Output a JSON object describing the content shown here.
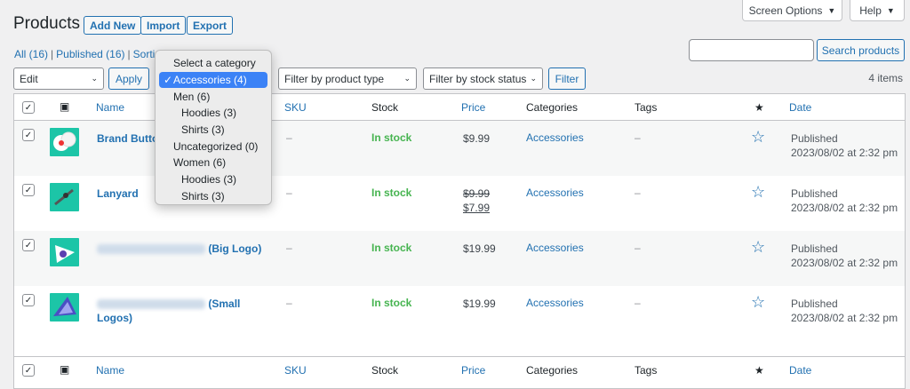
{
  "page": {
    "title": "Products",
    "add_new": "Add New",
    "import": "Import",
    "export": "Export"
  },
  "topbar": {
    "screen_options": "Screen Options",
    "help": "Help"
  },
  "views": {
    "all": "All (16)",
    "published": "Published (16)",
    "sorting": "Sorting"
  },
  "search": {
    "button": "Search products",
    "value": ""
  },
  "filters": {
    "bulk_action": "Edit",
    "apply": "Apply",
    "product_type": "Filter by product type",
    "stock_status": "Filter by stock status",
    "filter": "Filter",
    "items_count": "4 items"
  },
  "columns": {
    "name": "Name",
    "sku": "SKU",
    "stock": "Stock",
    "price": "Price",
    "categories": "Categories",
    "tags": "Tags",
    "date": "Date"
  },
  "category_dropdown": {
    "placeholder": "Select a category",
    "options": [
      {
        "label": "Accessories  (4)",
        "level": 0,
        "selected": true
      },
      {
        "label": "Men  (6)",
        "level": 1,
        "selected": false
      },
      {
        "label": "Hoodies  (3)",
        "level": 2,
        "selected": false
      },
      {
        "label": "Shirts  (3)",
        "level": 2,
        "selected": false
      },
      {
        "label": "Uncategorized  (0)",
        "level": 1,
        "selected": false
      },
      {
        "label": "Women  (6)",
        "level": 1,
        "selected": false
      },
      {
        "label": "Hoodies  (3)",
        "level": 2,
        "selected": false
      },
      {
        "label": "Shirts  (3)",
        "level": 2,
        "selected": false
      }
    ]
  },
  "products": [
    {
      "name": "Brand Butto",
      "name_line2": "",
      "blurred_prefix": false,
      "sku": "–",
      "stock": "In stock",
      "price": "$9.99",
      "sale_price": "",
      "category": "Accessories",
      "tags": "–",
      "status": "Published",
      "date": "2023/08/02 at 2:32 pm"
    },
    {
      "name": "Lanyard",
      "name_line2": "",
      "blurred_prefix": false,
      "sku": "–",
      "stock": "In stock",
      "price": "$9.99",
      "sale_price": "$7.99",
      "category": "Accessories",
      "tags": "–",
      "status": "Published",
      "date": "2023/08/02 at 2:32 pm"
    },
    {
      "name": "(Big Logo)",
      "name_line2": "",
      "blurred_prefix": true,
      "sku": "–",
      "stock": "In stock",
      "price": "$19.99",
      "sale_price": "",
      "category": "Accessories",
      "tags": "–",
      "status": "Published",
      "date": "2023/08/02 at 2:32 pm"
    },
    {
      "name": "(Small",
      "name_line2": "Logos)",
      "blurred_prefix": true,
      "sku": "–",
      "stock": "In stock",
      "price": "$19.99",
      "sale_price": "",
      "category": "Accessories",
      "tags": "–",
      "status": "Published",
      "date": "2023/08/02 at 2:32 pm"
    }
  ],
  "colors": {
    "link": "#2271b1",
    "in_stock": "#46b450",
    "thumb_bg": "#1cc5a7",
    "dropdown_selected": "#3b82f6"
  }
}
